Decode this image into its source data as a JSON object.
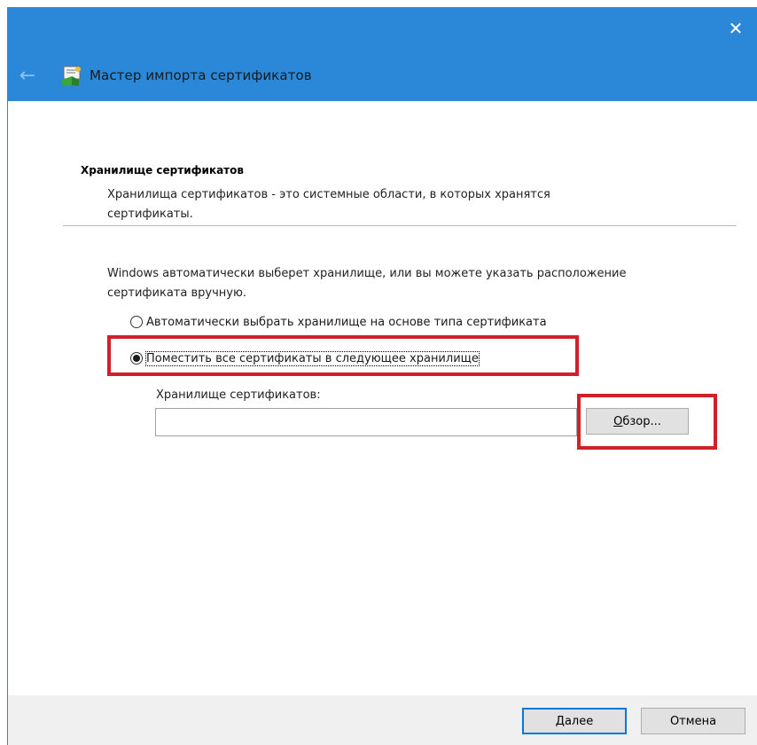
{
  "window": {
    "title": "Мастер импорта сертификатов",
    "close_glyph": "✕",
    "back_glyph": "←",
    "icons": [
      "close-icon",
      "back-arrow-icon",
      "certificate-wizard-icon"
    ],
    "accent_color": "#2b88d8"
  },
  "section": {
    "header": "Хранилище сертификатов",
    "description": "Хранилища сертификатов - это системные области, в которых хранятся сертификаты."
  },
  "main": {
    "intro": "Windows автоматически выберет хранилище, или вы можете указать расположение сертификата вручную.",
    "radio_auto": {
      "label": "Автоматически выбрать хранилище на основе типа сертификата",
      "selected": false
    },
    "radio_manual": {
      "label": "Поместить все сертификаты в следующее хранилище",
      "selected": true
    },
    "store_label": "Хранилище сертификатов:",
    "store_value": "",
    "browse": {
      "accel": "О",
      "rest": "бзор..."
    }
  },
  "footer": {
    "next": {
      "accel": "Д",
      "rest": "алее"
    },
    "cancel_label": "Отмена"
  },
  "highlight_color": "#d0202a"
}
